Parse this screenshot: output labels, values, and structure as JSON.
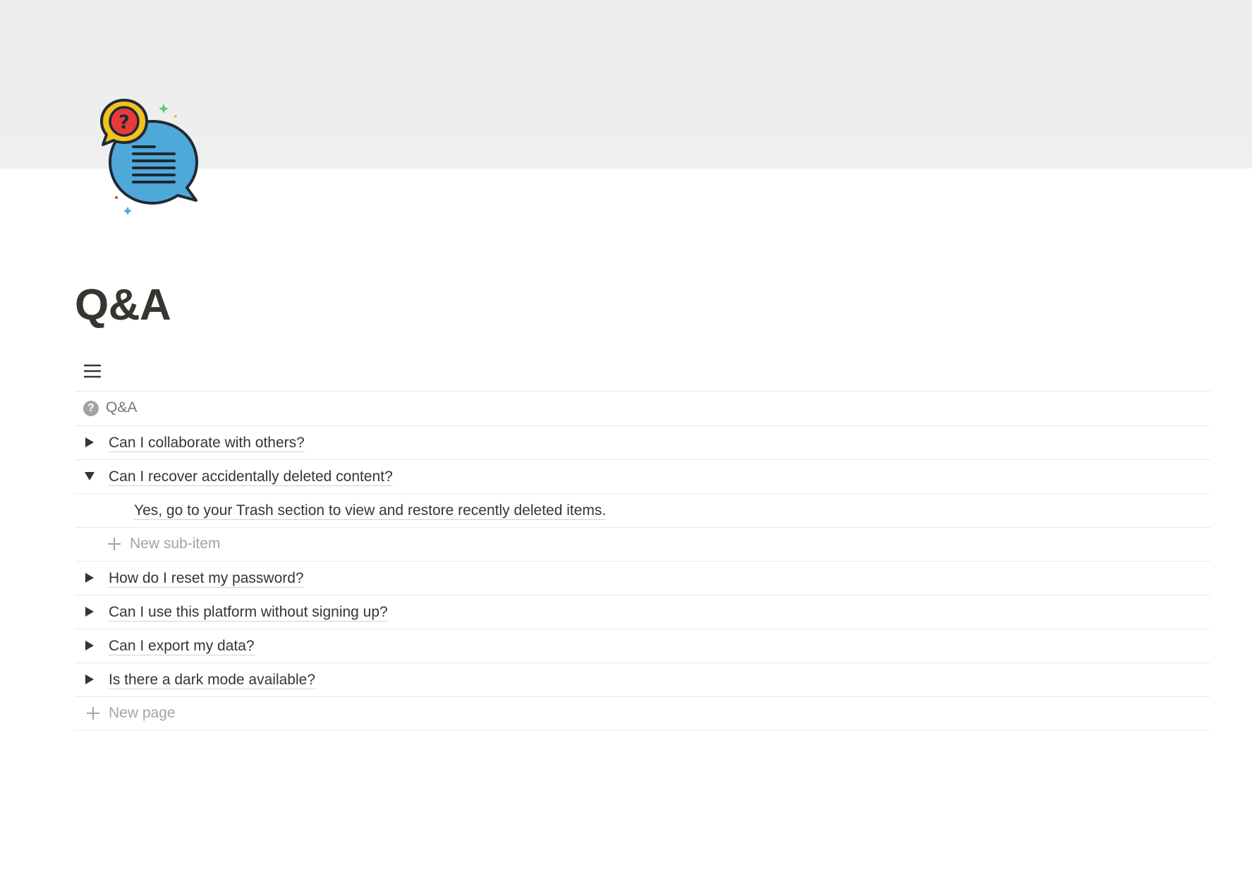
{
  "page": {
    "title": "Q&A",
    "icon": "speech-bubble-question-icon"
  },
  "view": {
    "menu_icon": "hamburger-menu-icon"
  },
  "table": {
    "header_label": "Q&A",
    "header_icon": "question-circle-icon",
    "rows": [
      {
        "title": "Can I collaborate with others?",
        "expanded": false
      },
      {
        "title": "Can I recover accidentally deleted content?",
        "expanded": true,
        "sub_items": [
          "Yes, go to your Trash section to view and restore recently deleted items."
        ],
        "new_sub_item_label": "New sub-item"
      },
      {
        "title": "How do I reset my password?",
        "expanded": false
      },
      {
        "title": "Can I use this platform without signing up?",
        "expanded": false
      },
      {
        "title": "Can I export my data?",
        "expanded": false
      },
      {
        "title": "Is there a dark mode available?",
        "expanded": false
      }
    ],
    "new_page_label": "New page"
  },
  "colors": {
    "text": "#37352f",
    "muted": "#787774",
    "placeholder": "#a5a4a0",
    "divider": "#e9e9e7",
    "cover": "#eeeeee",
    "icon_bubble_blue": "#4fa9d8",
    "icon_bubble_yellow": "#f4c21c",
    "icon_question_red": "#e63b3b"
  }
}
